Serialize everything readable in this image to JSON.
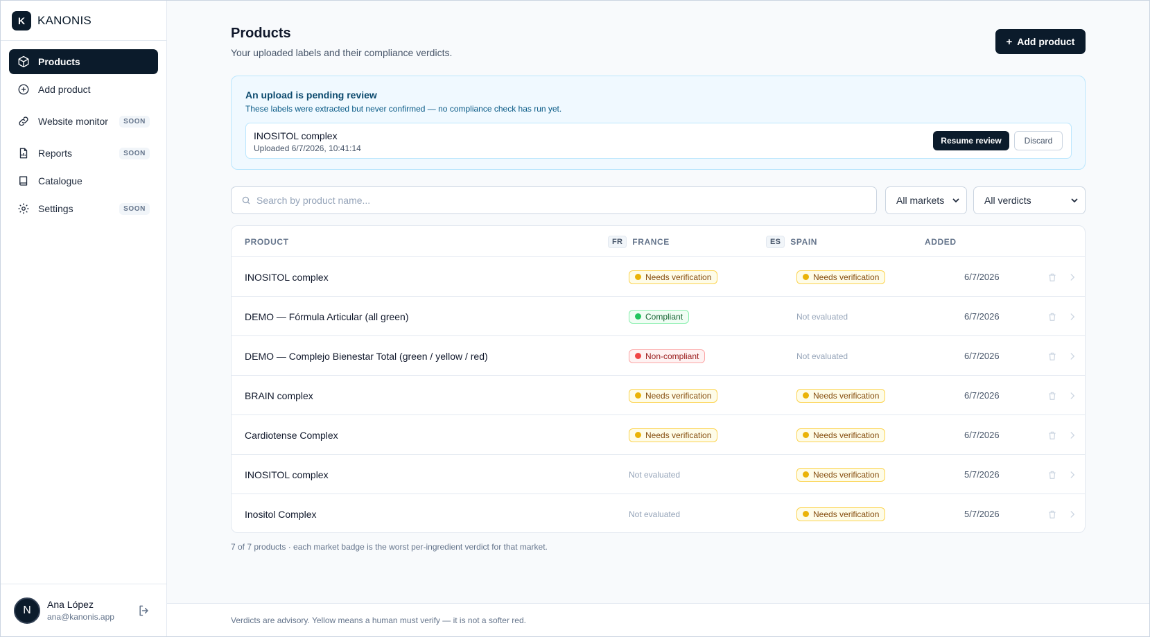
{
  "brand": {
    "logo_letter": "K",
    "name": "KANONIS"
  },
  "sidebar": {
    "items": [
      {
        "label": "Products",
        "soon": ""
      },
      {
        "label": "Add product",
        "soon": ""
      },
      {
        "label": "Website monitor",
        "soon": "SOON"
      },
      {
        "label": "Reports",
        "soon": "SOON"
      },
      {
        "label": "Catalogue",
        "soon": ""
      },
      {
        "label": "Settings",
        "soon": "SOON"
      }
    ],
    "user": {
      "initial": "N",
      "name": "Ana López",
      "email": "ana@kanonis.app"
    }
  },
  "header": {
    "title": "Products",
    "subtitle": "Your uploaded labels and their compliance verdicts.",
    "add_label": "Add product"
  },
  "pending": {
    "title": "An upload is pending review",
    "description": "These labels were extracted but never confirmed — no compliance check has run yet.",
    "product": "INOSITOL complex",
    "uploaded": "Uploaded 6/7/2026, 10:41:14",
    "resume_label": "Resume review",
    "discard_label": "Discard"
  },
  "filters": {
    "search_placeholder": "Search by product name...",
    "markets": "All markets",
    "verdicts": "All verdicts"
  },
  "table": {
    "headers": {
      "product": "PRODUCT",
      "fr_code": "FR",
      "fr": "FRANCE",
      "es_code": "ES",
      "es": "SPAIN",
      "added": "ADDED"
    },
    "rows": [
      {
        "product": "INOSITOL complex",
        "fr": "Needs verification",
        "es": "Needs verification",
        "added": "6/7/2026"
      },
      {
        "product": "DEMO — Fórmula Articular (all green)",
        "fr": "Compliant",
        "es": "Not evaluated",
        "added": "6/7/2026"
      },
      {
        "product": "DEMO — Complejo Bienestar Total (green / yellow / red)",
        "fr": "Non-compliant",
        "es": "Not evaluated",
        "added": "6/7/2026"
      },
      {
        "product": "BRAIN complex",
        "fr": "Needs verification",
        "es": "Needs verification",
        "added": "6/7/2026"
      },
      {
        "product": "Cardiotense Complex",
        "fr": "Needs verification",
        "es": "Needs verification",
        "added": "6/7/2026"
      },
      {
        "product": "INOSITOL complex",
        "fr": "Not evaluated",
        "es": "Needs verification",
        "added": "5/7/2026"
      },
      {
        "product": "Inositol Complex",
        "fr": "Not evaluated",
        "es": "Needs verification",
        "added": "5/7/2026"
      }
    ]
  },
  "footnote": "7 of 7 products · each market badge is the worst per-ingredient verdict for that market.",
  "bottom_note": "Verdicts are advisory. Yellow means a human must verify — it is not a softer red.",
  "colors": {
    "primary": "#0b1b2b",
    "needs": "#eab308",
    "compliant": "#22c55e",
    "noncompliant": "#ef4444"
  }
}
